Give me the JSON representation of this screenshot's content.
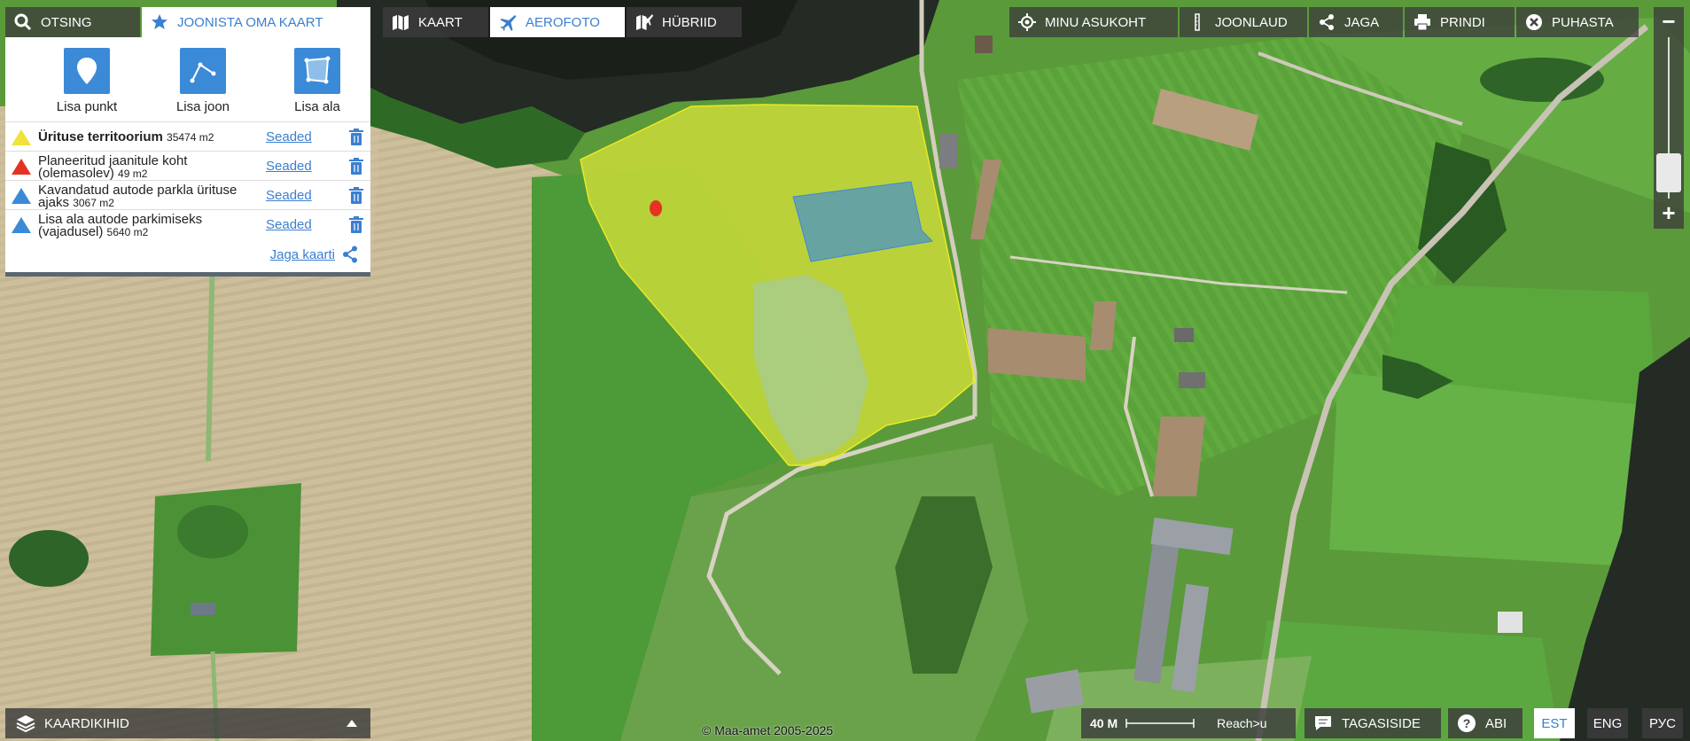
{
  "tabs": {
    "otsing": "OTSING",
    "joonista": "JOONISTA OMA KAART"
  },
  "map_types": [
    "KAART",
    "AEROFOTO",
    "HÜBRIID"
  ],
  "active_map_type": "AEROFOTO",
  "right_tools": [
    "MINU ASUKOHT",
    "JOONLAUD",
    "JAGA",
    "PRINDI",
    "PUHASTA"
  ],
  "draw_tools": {
    "point": "Lisa punkt",
    "line": "Lisa joon",
    "area": "Lisa ala"
  },
  "layers": [
    {
      "name": "Ürituse territoorium",
      "size": "35474 m2",
      "bold": true,
      "color": "#f0e23a",
      "settings": "Seaded"
    },
    {
      "name": "Planeeritud jaanitule koht (olemasolev)",
      "size": "49 m2",
      "color": "#e53222",
      "settings": "Seaded"
    },
    {
      "name": "Kavandatud autode parkla ürituse ajaks",
      "size": "3067 m2",
      "color": "#3b8ad8",
      "settings": "Seaded"
    },
    {
      "name": "Lisa ala autode parkimiseks (vajadusel)",
      "size": "5640 m2",
      "color": "#3b8ad8",
      "settings": "Seaded"
    }
  ],
  "share_link": "Jaga kaarti",
  "bottom": {
    "layers": "KAARDIKIHID",
    "scale": "40 M",
    "reach": "Reach>u",
    "feedback": "TAGASISIDE",
    "help": "ABI",
    "copyright": "© Maa-amet 2005-2025"
  },
  "languages": [
    "EST",
    "ENG",
    "РУС"
  ],
  "active_language": "EST",
  "accent_color": "#3b7fd0"
}
